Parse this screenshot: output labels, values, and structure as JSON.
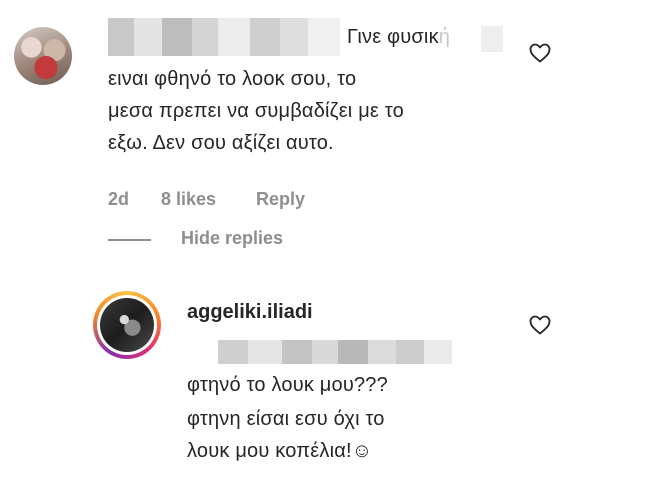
{
  "comment1": {
    "text_line1": "Γινε φυσικ",
    "text_line1_faded": "ή",
    "text_line2": "ειναι φθηνό το λοοκ σου, το",
    "text_line3": "μεσα πρεπει να συμβαδίζει με το",
    "text_line4": "εξω. Δεν σου αξίζει αυτο.",
    "age": "2d",
    "likes": "8 likes",
    "reply_label": "Reply",
    "hide_replies_label": "Hide replies",
    "like_icon": "heart-outline-icon"
  },
  "reply1": {
    "username": "aggeliki.iliadi",
    "text_line1": "φτηνό το λουκ μου???",
    "text_line2": "φτηνη είσαι εσυ όχι το",
    "text_line3": "λουκ μου κοπέλια!☺",
    "like_icon": "heart-outline-icon"
  },
  "colors": {
    "text": "#262626",
    "meta": "#8e8e8e",
    "story_ring": "#dd2a7b"
  }
}
